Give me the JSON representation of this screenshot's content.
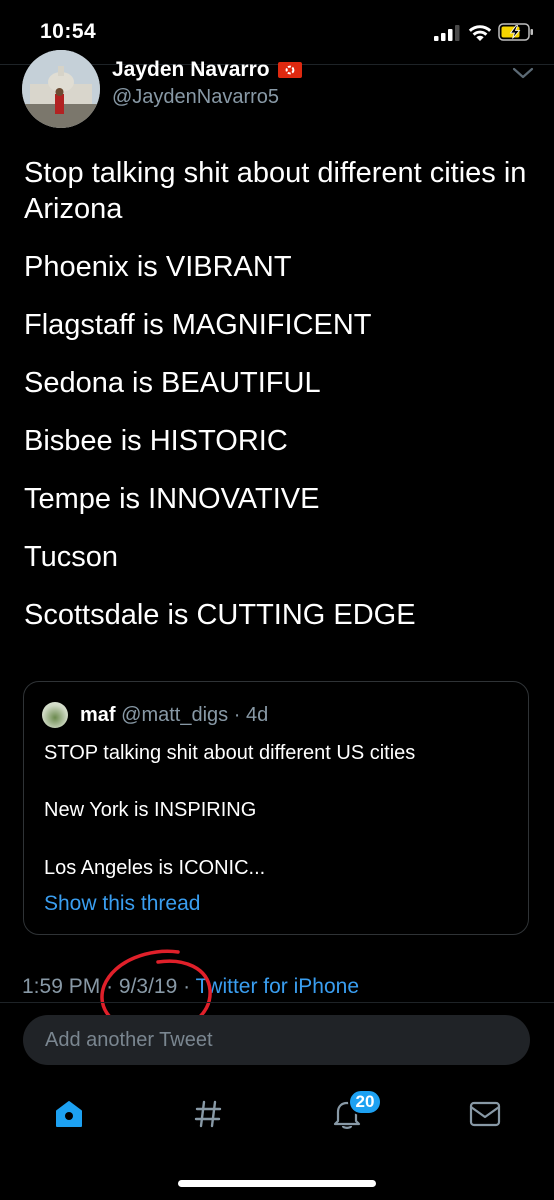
{
  "status_bar": {
    "time": "10:54"
  },
  "tweet": {
    "author_name": "Jayden Navarro",
    "author_handle": "@JaydenNavarro5",
    "text_lines": [
      "Stop talking shit about different cities in Arizona",
      "Phoenix is VIBRANT",
      "Flagstaff is MAGNIFICENT",
      "Sedona is BEAUTIFUL",
      "Bisbee is HISTORIC",
      "Tempe is INNOVATIVE",
      "Tucson",
      "Scottsdale is CUTTING EDGE"
    ],
    "time": "1:59 PM",
    "date": "9/3/19",
    "separator": "·",
    "source": "Twitter for iPhone"
  },
  "quoted_tweet": {
    "name": "maf",
    "handle": "@matt_digs",
    "age": "4d",
    "lines": [
      "STOP talking shit about different US cities",
      "New York is INSPIRING",
      "Los Angeles is ICONIC..."
    ],
    "show_thread_label": "Show this thread"
  },
  "reply": {
    "placeholder": "Add another Tweet"
  },
  "tab_bar": {
    "notifications_badge": "20"
  },
  "colors": {
    "accent": "#1da1f2",
    "link": "#3a9ef0",
    "muted": "#8899a6",
    "annotation_circle": "#e0202a"
  }
}
